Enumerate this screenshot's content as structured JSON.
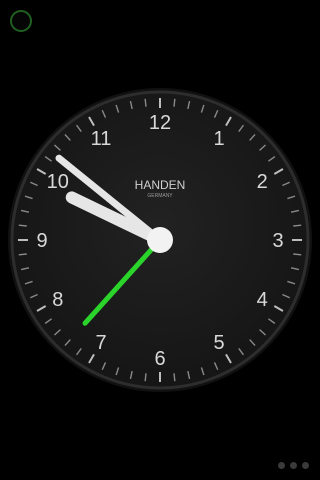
{
  "status": {
    "icon": "status-ring-icon",
    "color": "#1f6f1f"
  },
  "clock": {
    "brand": "HANDEN",
    "subtitle": "GERMANY",
    "numerals": [
      "12",
      "1",
      "2",
      "3",
      "4",
      "5",
      "6",
      "7",
      "8",
      "9",
      "10",
      "11"
    ],
    "time": {
      "hour": 9,
      "minute": 51.5,
      "second": 37
    },
    "colors": {
      "face": "#1b1b1b",
      "rim": "#3a3a3a",
      "text": "#d9d9d9",
      "hand": "#e6e6e6",
      "second_hand": "#2ad42a"
    }
  },
  "pager": {
    "pages": 3,
    "active": 0,
    "icon": "page-indicator-dots"
  }
}
